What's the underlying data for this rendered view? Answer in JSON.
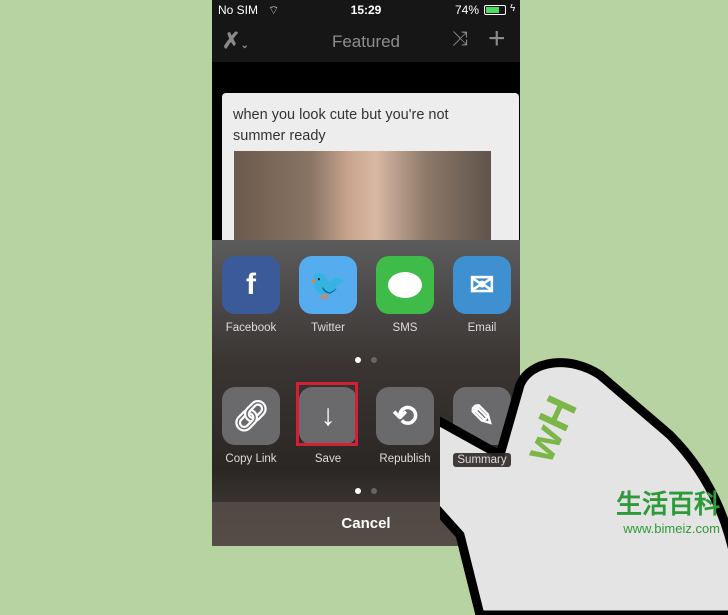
{
  "status": {
    "carrier": "No SIM",
    "time": "15:29",
    "battery": "74%",
    "battery_level": 0.74
  },
  "navbar": {
    "title": "Featured"
  },
  "card": {
    "text": "when you look cute but you're not summer ready"
  },
  "share_apps": [
    {
      "label": "Facebook",
      "icon": "facebook-icon",
      "color": "#3b5a9a"
    },
    {
      "label": "Twitter",
      "icon": "twitter-bird-icon",
      "color": "#55acee"
    },
    {
      "label": "SMS",
      "icon": "message-bubble-icon",
      "color": "#3fbb4a"
    },
    {
      "label": "Email",
      "icon": "envelope-icon",
      "color": "#3f90d1"
    }
  ],
  "actions": [
    {
      "label": "Copy Link",
      "icon": "link-icon"
    },
    {
      "label": "Save",
      "icon": "download-arrow-icon"
    },
    {
      "label": "Republish",
      "icon": "repeat-icon"
    },
    {
      "label": "Summary",
      "icon": "pencil-icon"
    }
  ],
  "cancel_label": "Cancel",
  "highlight_color": "#d32032",
  "watermark": {
    "title": "生活百科",
    "url": "www.bimeiz.com"
  }
}
